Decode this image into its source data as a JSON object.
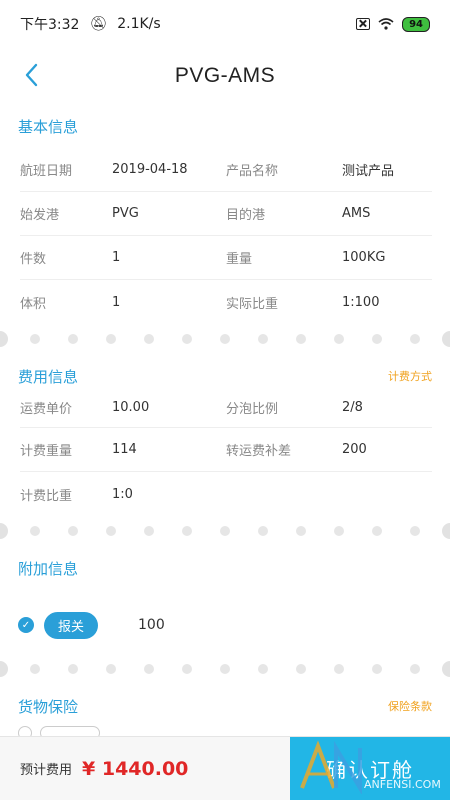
{
  "status_bar": {
    "time": "下午3:32",
    "speed": "2.1K/s",
    "battery": "94"
  },
  "nav": {
    "title": "PVG-AMS"
  },
  "basic": {
    "title": "基本信息",
    "rows": [
      {
        "l1": "航班日期",
        "v1": "2019-04-18",
        "l2": "产品名称",
        "v2": "测试产品"
      },
      {
        "l1": "始发港",
        "v1": "PVG",
        "l2": "目的港",
        "v2": "AMS"
      },
      {
        "l1": "件数",
        "v1": "1",
        "l2": "重量",
        "v2": "100KG"
      },
      {
        "l1": "体积",
        "v1": "1",
        "l2": "实际比重",
        "v2": "1:100"
      }
    ]
  },
  "fee": {
    "title": "费用信息",
    "link": "计费方式",
    "rows": [
      {
        "l1": "运费单价",
        "v1": "10.00",
        "l2": "分泡比例",
        "v2": "2/8"
      },
      {
        "l1": "计费重量",
        "v1": "114",
        "l2": "转运费补差",
        "v2": "200"
      },
      {
        "l1": "计费比重",
        "v1": "1:0"
      }
    ]
  },
  "extra": {
    "title": "附加信息",
    "tag": "报关",
    "value": "100"
  },
  "insurance": {
    "title": "货物保险",
    "link": "保险条款"
  },
  "bottom": {
    "est_label": "预计费用",
    "est_value": "¥ 1440.00",
    "confirm": "确认订舱"
  },
  "watermark": "ANFENSI.COM",
  "colors": {
    "accent": "#2a9fd8",
    "link": "#f0a21f",
    "price": "#e02727",
    "button": "#22b6e6"
  }
}
